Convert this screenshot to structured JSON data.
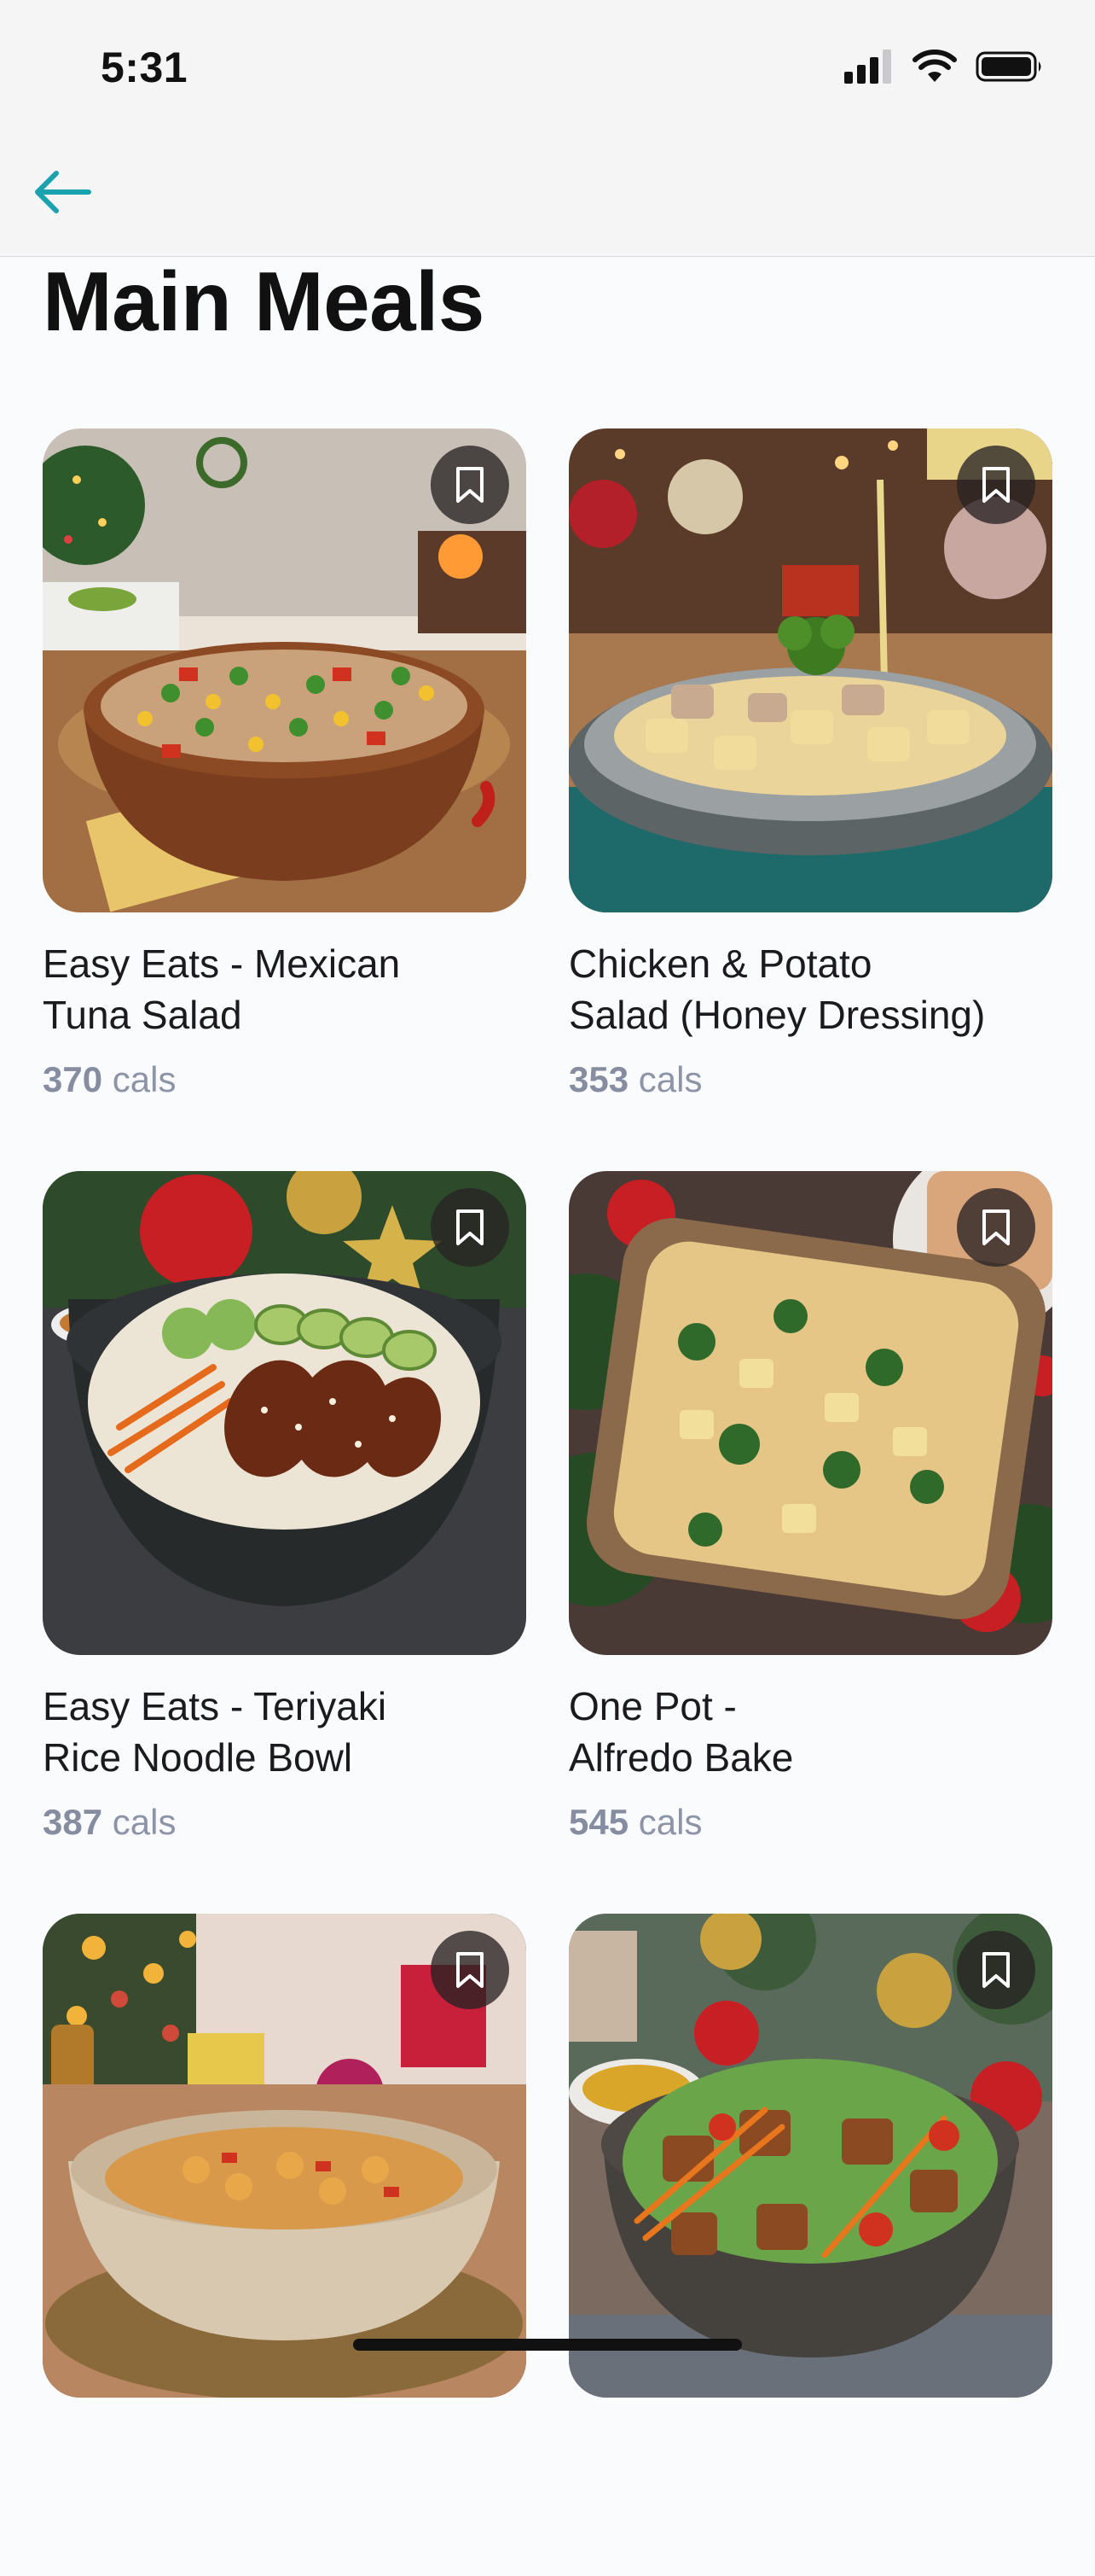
{
  "status_bar": {
    "time": "5:31"
  },
  "nav": {
    "back_icon": "arrow-left-icon",
    "accent": "#1aa3ae"
  },
  "page": {
    "title": "Main Meals"
  },
  "meals": [
    {
      "title": "Easy Eats - Mexican\nTuna Salad",
      "cals": "370",
      "cals_unit": "cals",
      "image": "tuna-salad-bowl"
    },
    {
      "title": "Chicken & Potato\nSalad (Honey Dressing)",
      "cals": "353",
      "cals_unit": "cals",
      "image": "chicken-potato-salad"
    },
    {
      "title": "Easy Eats - Teriyaki\nRice Noodle Bowl",
      "cals": "387",
      "cals_unit": "cals",
      "image": "teriyaki-noodle-bowl"
    },
    {
      "title": "One Pot -\nAlfredo Bake",
      "cals": "545",
      "cals_unit": "cals",
      "image": "alfredo-bake"
    },
    {
      "title": "",
      "cals": "",
      "cals_unit": "",
      "image": "pasta-bowl"
    },
    {
      "title": "",
      "cals": "",
      "cals_unit": "",
      "image": "tofu-salad-bowl"
    }
  ]
}
